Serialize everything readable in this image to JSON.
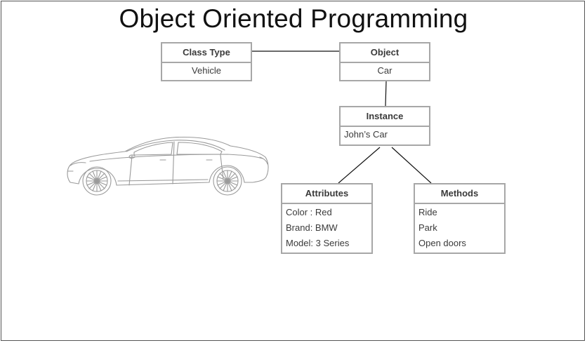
{
  "title": "Object Oriented Programming",
  "boxes": {
    "class_type": {
      "header": "Class Type",
      "items": [
        "Vehicle"
      ]
    },
    "object": {
      "header": "Object",
      "items": [
        "Car"
      ]
    },
    "instance": {
      "header": "Instance",
      "items": [
        "John’s Car"
      ]
    },
    "attributes": {
      "header": "Attributes",
      "items": [
        "Color : Red",
        "Brand: BMW",
        "Model: 3 Series"
      ]
    },
    "methods": {
      "header": "Methods",
      "items": [
        "Ride",
        "Park",
        "Open doors"
      ]
    }
  },
  "colors": {
    "box_border": "#a7a7a7",
    "connector": "#111111",
    "text": "#3a3a3a",
    "title": "#111111",
    "car_outline": "#9a9a9a"
  },
  "illustration": "car-sedan-icon"
}
